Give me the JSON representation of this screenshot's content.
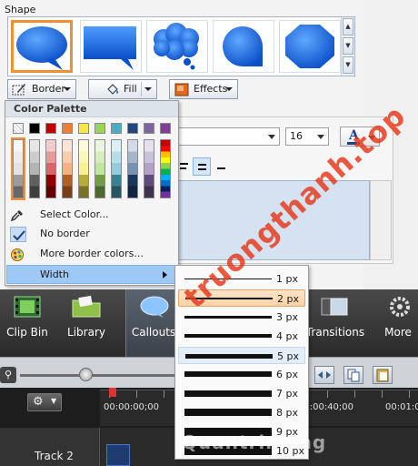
{
  "shape_panel": {
    "title": "Shape",
    "toolbar": {
      "border_label": "Border",
      "fill_label": "Fill",
      "effects_label": "Effects"
    }
  },
  "text_props": {
    "font_size": "16"
  },
  "border_menu": {
    "palette_header": "Color Palette",
    "items": {
      "select_color": "Select Color...",
      "no_border": "No border",
      "more_colors": "More border colors...",
      "width": "Width"
    }
  },
  "palette": {
    "top_row": [
      "#ffffff",
      "#000000",
      "#c00000",
      "#f07d32",
      "#f4e64b",
      "#9ad35c",
      "#4bacc6",
      "#1f497d",
      "#8064a2",
      "#7f3f98"
    ],
    "standard_row": [
      "#c00000",
      "#ff0000",
      "#ffc000",
      "#ffff00",
      "#92d050",
      "#00b050",
      "#00b0f0",
      "#0070c0",
      "#002060",
      "#7030a0"
    ]
  },
  "width_menu": {
    "items": [
      "1 px",
      "2 px",
      "3 px",
      "4 px",
      "5 px",
      "6 px",
      "7 px",
      "8 px",
      "9 px",
      "10 px"
    ],
    "selected": "2 px"
  },
  "bottom_toolbar": {
    "clip_bin": "Clip Bin",
    "library": "Library",
    "callouts": "Callouts",
    "transitions": "Transitions",
    "more": "More"
  },
  "timeline": {
    "timestamps": [
      "00:00:00;00",
      "00:00:40;00",
      "00:01:0"
    ],
    "track_name": "Track 2"
  },
  "watermark": {
    "line1": "truongthanh.top",
    "line2": "Quantrimang"
  },
  "colors": {
    "accent_blue": "#1f6fd6",
    "selection_orange": "#f0902f"
  }
}
